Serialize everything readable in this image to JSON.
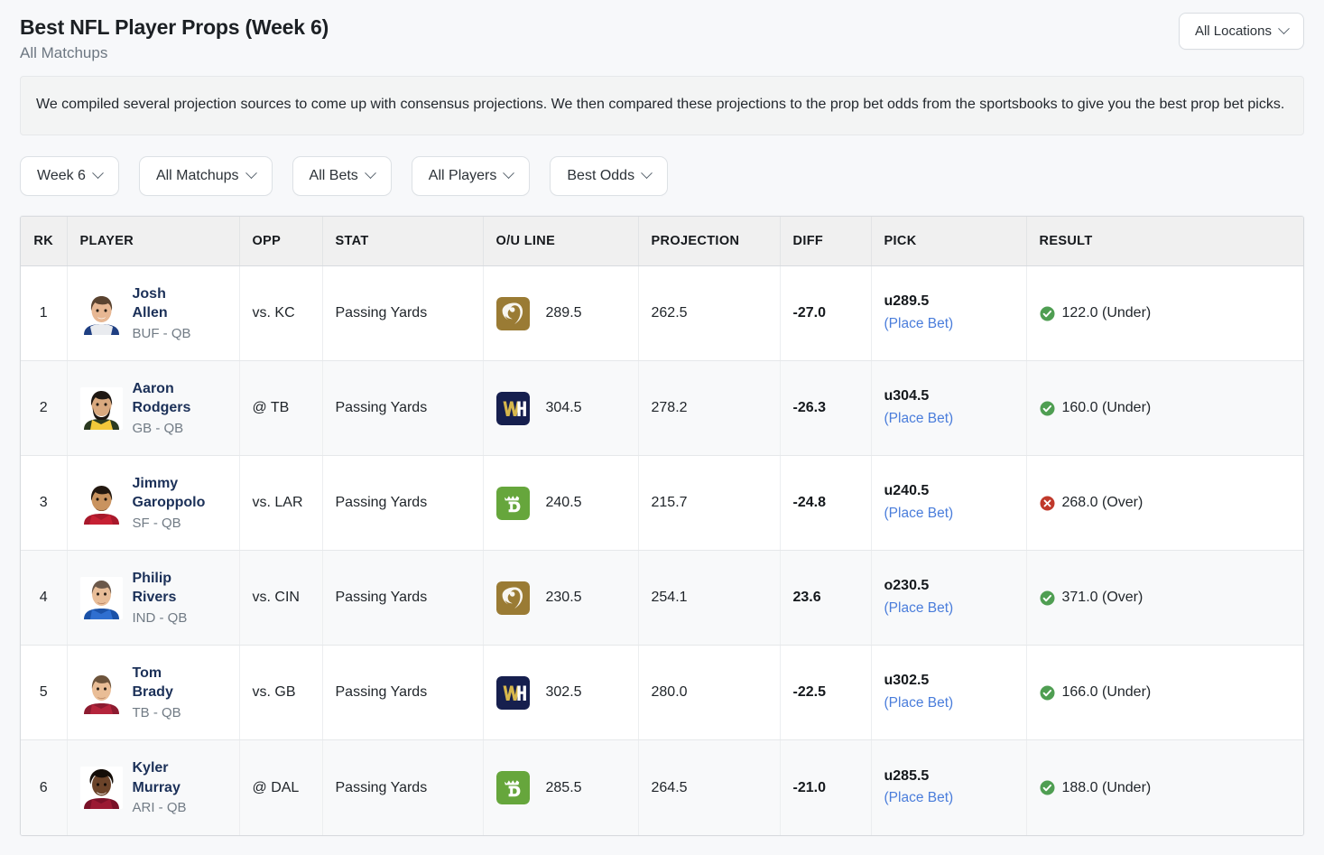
{
  "header": {
    "title": "Best NFL Player Props (Week 6)",
    "subtitle": "All Matchups",
    "locations_label": "All Locations"
  },
  "description": "We compiled several projection sources to come up with consensus projections. We then compared these projections to the prop bet odds from the sportsbooks to give you the best prop bet picks.",
  "filters": [
    {
      "label": "Week 6"
    },
    {
      "label": "All Matchups"
    },
    {
      "label": "All Bets"
    },
    {
      "label": "All Players"
    },
    {
      "label": "Best Odds"
    }
  ],
  "table": {
    "columns": [
      "RK",
      "PLAYER",
      "OPP",
      "STAT",
      "O/U LINE",
      "PROJECTION",
      "DIFF",
      "PICK",
      "RESULT"
    ],
    "place_bet_label": "(Place Bet)",
    "rows": [
      {
        "rank": "1",
        "player_name": "Josh Allen",
        "player_meta": "BUF - QB",
        "opp": "vs. KC",
        "stat": "Passing Yards",
        "book": "betmgm",
        "ou_line": "289.5",
        "projection": "262.5",
        "diff": "-27.0",
        "pick": "u289.5",
        "result_status": "win",
        "result": "122.0 (Under)"
      },
      {
        "rank": "2",
        "player_name": "Aaron Rodgers",
        "player_meta": "GB - QB",
        "opp": "@ TB",
        "stat": "Passing Yards",
        "book": "williamhill",
        "ou_line": "304.5",
        "projection": "278.2",
        "diff": "-26.3",
        "pick": "u304.5",
        "result_status": "win",
        "result": "160.0 (Under)"
      },
      {
        "rank": "3",
        "player_name": "Jimmy Garoppolo",
        "player_meta": "SF - QB",
        "opp": "vs. LAR",
        "stat": "Passing Yards",
        "book": "draftkings",
        "ou_line": "240.5",
        "projection": "215.7",
        "diff": "-24.8",
        "pick": "u240.5",
        "result_status": "loss",
        "result": "268.0 (Over)"
      },
      {
        "rank": "4",
        "player_name": "Philip Rivers",
        "player_meta": "IND - QB",
        "opp": "vs. CIN",
        "stat": "Passing Yards",
        "book": "betmgm",
        "ou_line": "230.5",
        "projection": "254.1",
        "diff": "23.6",
        "pick": "o230.5",
        "result_status": "win",
        "result": "371.0 (Over)"
      },
      {
        "rank": "5",
        "player_name": "Tom Brady",
        "player_meta": "TB - QB",
        "opp": "vs. GB",
        "stat": "Passing Yards",
        "book": "williamhill",
        "ou_line": "302.5",
        "projection": "280.0",
        "diff": "-22.5",
        "pick": "u302.5",
        "result_status": "win",
        "result": "166.0 (Under)"
      },
      {
        "rank": "6",
        "player_name": "Kyler Murray",
        "player_meta": "ARI - QB",
        "opp": "@ DAL",
        "stat": "Passing Yards",
        "book": "draftkings",
        "ou_line": "285.5",
        "projection": "264.5",
        "diff": "-21.0",
        "pick": "u285.5",
        "result_status": "win",
        "result": "188.0 (Under)"
      }
    ]
  },
  "colors": {
    "page_bg": "#f7f8fa",
    "link": "#4a7ddb",
    "player_name": "#1b3058",
    "win_green": "#4f9e52",
    "loss_red": "#c0392b",
    "betmgm_gold": "#9a7b34",
    "williamhill_navy": "#161f4e",
    "draftkings_green": "#66a63c"
  },
  "icons": {
    "chevron_down": "chevron-down-icon",
    "win": "check-circle-icon",
    "loss": "x-circle-icon"
  }
}
